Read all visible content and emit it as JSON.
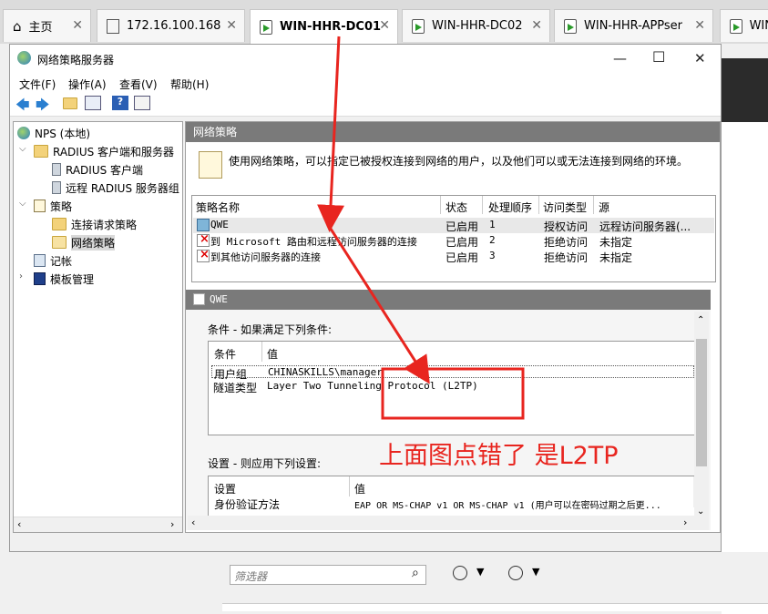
{
  "tabs": [
    {
      "label": "主页",
      "icon": "home-icon"
    },
    {
      "label": "172.16.100.168",
      "icon": "document-icon"
    },
    {
      "label": "WIN-HHR-DC01",
      "icon": "vm-icon",
      "active": true
    },
    {
      "label": "WIN-HHR-DC02",
      "icon": "vm-icon"
    },
    {
      "label": "WIN-HHR-APPser",
      "icon": "vm-icon"
    },
    {
      "label": "WIN",
      "icon": "vm-icon"
    }
  ],
  "window": {
    "title": "网络策略服务器"
  },
  "menu": [
    "文件(F)",
    "操作(A)",
    "查看(V)",
    "帮助(H)"
  ],
  "tree": {
    "root": "NPS (本地)",
    "radius": "RADIUS 客户端和服务器",
    "radius_clients": "RADIUS 客户端",
    "remote_groups": "远程 RADIUS 服务器组",
    "policies": "策略",
    "conn_request": "连接请求策略",
    "network_policies": "网络策略",
    "accounting": "记帐",
    "templates": "模板管理"
  },
  "pane": {
    "header": "网络策略",
    "description": "使用网络策略，可以指定已被授权连接到网络的用户，以及他们可以或无法连接到网络的环境。",
    "columns": [
      "策略名称",
      "状态",
      "处理顺序",
      "访问类型",
      "源"
    ],
    "rows": [
      {
        "name": "QWE",
        "status": "已启用",
        "order": "1",
        "access": "授权访问",
        "source": "远程访问服务器(..."
      },
      {
        "name": "到 Microsoft 路由和远程访问服务器的连接",
        "status": "已启用",
        "order": "2",
        "access": "拒绝访问",
        "source": "未指定"
      },
      {
        "name": "到其他访问服务器的连接",
        "status": "已启用",
        "order": "3",
        "access": "拒绝访问",
        "source": "未指定"
      }
    ]
  },
  "detail": {
    "title": "QWE",
    "conditions_label": "条件 - 如果满足下列条件:",
    "cond_columns": [
      "条件",
      "值"
    ],
    "conditions": [
      {
        "name": "用户组",
        "value": "CHINASKILLS\\manager"
      },
      {
        "name": "隧道类型",
        "value": "Layer Two Tunneling Protocol (L2TP)"
      }
    ],
    "settings_label": "设置 - 则应用下列设置:",
    "set_columns": [
      "设置",
      "值"
    ],
    "settings": [
      {
        "name": "身份验证方法",
        "value": "EAP OR MS-CHAP v1 OR MS-CHAP v1 (用户可以在密码过期之后更..."
      }
    ]
  },
  "filter_placeholder": "筛选器",
  "annotation": "上面图点错了 是L2TP",
  "colors": {
    "annotation": "#e8251f",
    "header_gray": "#7a7a7a",
    "selection": "#d9d9d9"
  }
}
